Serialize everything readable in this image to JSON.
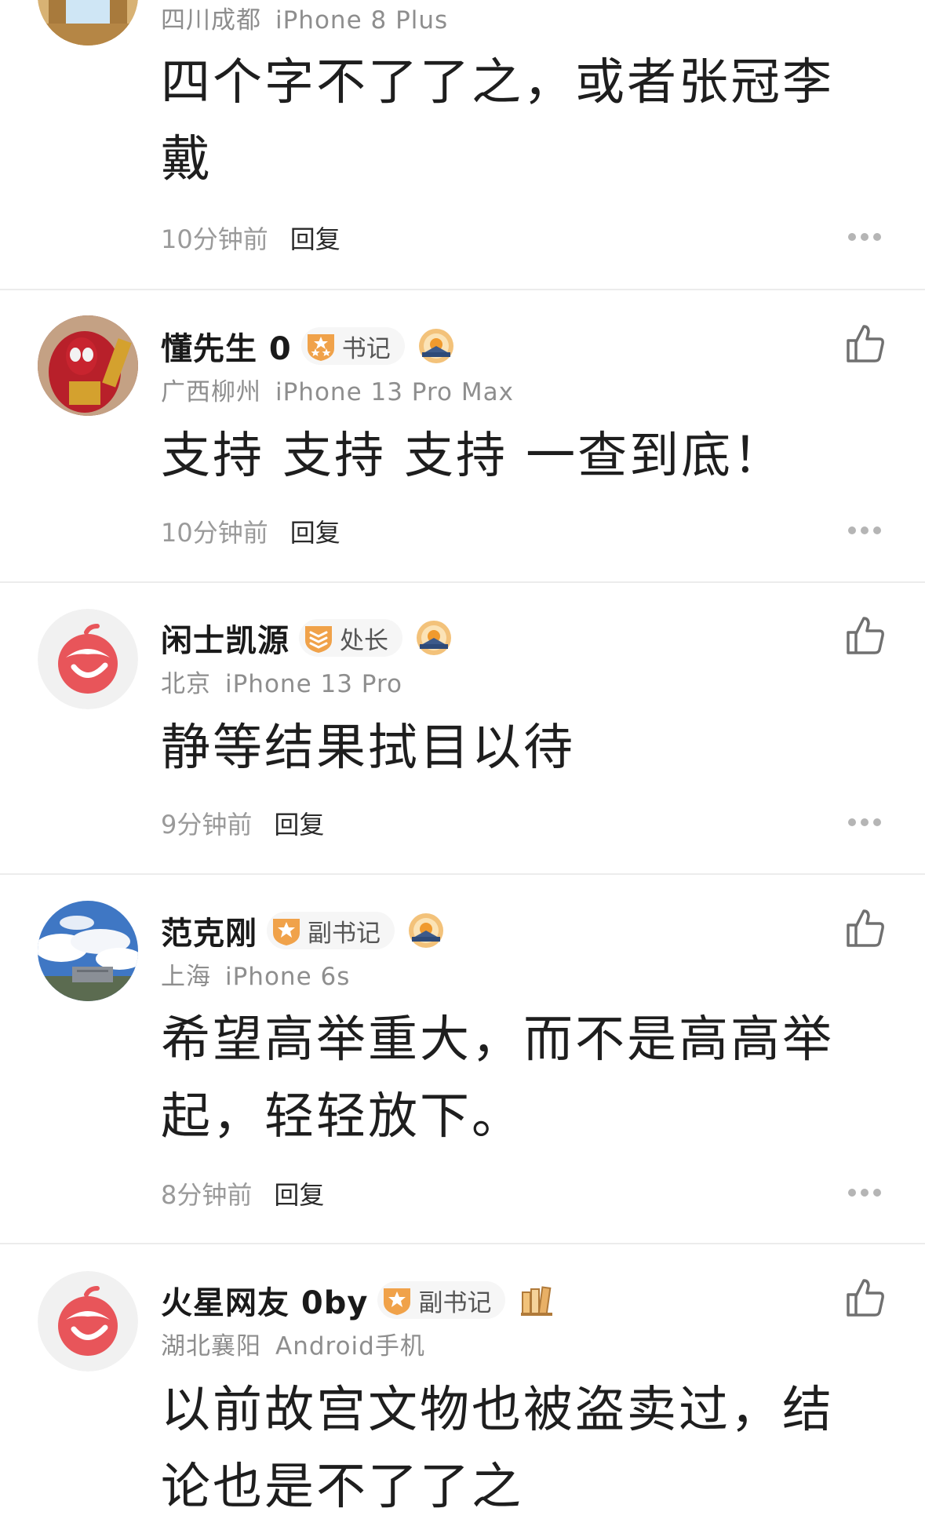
{
  "comments": [
    {
      "location": "四川成都",
      "device": "iPhone 8 Plus",
      "text": "四个字不了了之，或者张冠李戴",
      "time": "10分钟前",
      "reply": "回复"
    },
    {
      "username": "懂先生 0",
      "rank": "书记",
      "location": "广西柳州",
      "device": "iPhone 13 Pro Max",
      "text": "支持 支持 支持 一查到底！",
      "time": "10分钟前",
      "reply": "回复"
    },
    {
      "username": "闲士凯源",
      "rank": "处长",
      "location": "北京",
      "device": "iPhone 13 Pro",
      "text": "静等结果拭目以待",
      "time": "9分钟前",
      "reply": "回复"
    },
    {
      "username": "范克刚",
      "rank": "副书记",
      "location": "上海",
      "device": "iPhone 6s",
      "text": "希望高举重大，而不是高高举起，轻轻放下。",
      "time": "8分钟前",
      "reply": "回复"
    },
    {
      "username": "火星网友 0by",
      "rank": "副书记",
      "location": "湖北襄阳",
      "device": "Android手机",
      "text": "以前故宫文物也被盗卖过，结论也是不了了之"
    }
  ],
  "icons": {
    "like": "thumbs-up-icon",
    "more": "more-dots-icon",
    "rank": "rank-shield-icon",
    "sunrise_badge": "sunrise-badge-icon",
    "books_badge": "books-badge-icon",
    "default_avatar": "default-avatar-logo"
  },
  "colors": {
    "rank_badge": "#f0a24a",
    "rank_star": "#ffffff",
    "default_avatar_red": "#e8555a",
    "time_text": "#9a9a9a",
    "meta_text": "#8e8e8e"
  }
}
